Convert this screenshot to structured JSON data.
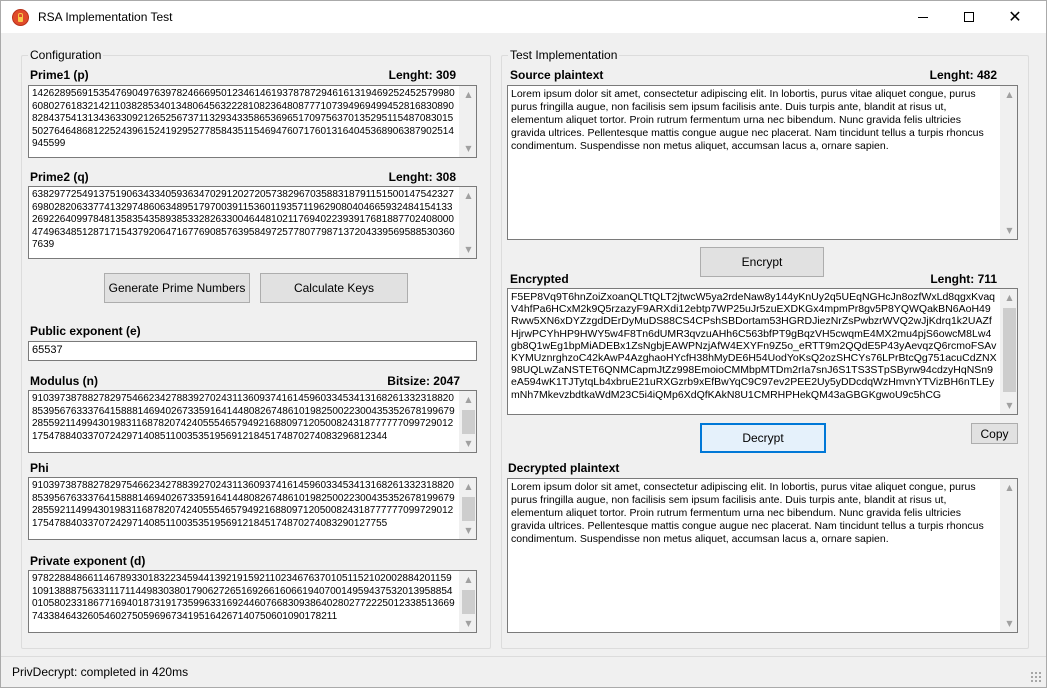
{
  "window": {
    "title": "RSA Implementation Test",
    "minimize_glyph": "",
    "close_glyph": "✕"
  },
  "config": {
    "group_title": "Configuration",
    "prime1": {
      "label": "Prime1 (p)",
      "length_label": "Lenght: 309",
      "value": "1426289569153547690497639782466695012346146193787872946161319469252452579980608027618321421103828534013480645632228108236480877710739496949945281683089082843754131343633092126525673711329343358653696517097563701352951154870830155027646486812252439615241929527785843511546947607176013164045368906387902514945599"
    },
    "prime2": {
      "label": "Prime2 (q)",
      "length_label": "Lenght: 308",
      "value": "63829772549137519063433405936347029120272057382967035883187911515001475423276980282063377413297486063489517970039115360119357119629080404665932484154133269226409978481358354358938533282633004644810211769402239391768188770240800047496348512871715437920647167769085763958497257780779871372043395695885303607639"
    },
    "generate_button": "Generate Prime Numbers",
    "calculate_button": "Calculate Keys",
    "public_exponent": {
      "label": "Public exponent (e)",
      "value": "65537"
    },
    "modulus": {
      "label": "Modulus (n)",
      "bitsize_label": "Bitsize: 2047",
      "value": "9103973878827829754662342788392702431136093741614596033453413168261332318820853956763337641588814694026733591641448082674861019825002230043535267819967928559211499430198311687820742405554657949216880971205008243187777770997290121754788403370724297140851100353519569121845174870274083296812344"
    },
    "phi": {
      "label": "Phi",
      "value": "9103973878827829754662342788392702431136093741614596033453413168261332318820853956763337641588814694026733591641448082674861019825002230043535267819967928559211499430198311687820742405554657949216880971205008243187777770997290121754788403370724297140851100353519569121845174870274083290127755"
    },
    "private_exponent": {
      "label": "Private exponent (d)",
      "value": "9782288486611467893301832234594413921915921102346763701051152102002884201159109138887563311171144983038017906272651692661606619407001495943753201395885401058023318677169401873191735996331692446076683093864028027722250123385136697433846432605460275059696734195164267140750601090178211"
    }
  },
  "test": {
    "group_title": "Test Implementation",
    "source": {
      "label": "Source plaintext",
      "length_label": "Lenght: 482",
      "value": "Lorem ipsum dolor sit amet, consectetur adipiscing elit. In lobortis, purus vitae aliquet congue, purus purus fringilla augue, non facilisis sem ipsum facilisis ante. Duis turpis ante, blandit at risus ut, elementum aliquet tortor. Proin rutrum fermentum urna nec bibendum. Nunc gravida felis ultricies gravida ultrices. Pellentesque mattis congue augue nec placerat. Nam tincidunt tellus a turpis rhoncus condimentum. Suspendisse non metus aliquet, accumsan lacus a, ornare sapien."
    },
    "encrypt_button": "Encrypt",
    "encrypted": {
      "label": "Encrypted",
      "length_label": "Lenght: 711",
      "value": "F5EP8Vq9T6hnZoiZxoanQLTtQLT2jtwcW5ya2rdeNaw8y144yKnUy2q5UEqNGHcJn8ozfWxLd8qgxKvaqV4hfPa6HCxM2k9Q5rzazyF9ARXdi12ebtp7WP25uJr5zuEXDKGx4mpmPr8gv5P8YQWQakBN6AoH49Rww5XN6xDYZzgdDErDyMuDS88CS4CPshSBDortam53HGRDJiezNrZsPwbzrWVQ2wJjKdrq1k2UAZfHjrwPCYhHP9HWY5w4F8Tn6dUMR3qvzuAHh6C563bfPT9gBqzVH5cwqmE4MX2mu4pjS6owcM8Lw4gb8Q1wEg1bpMiADEBx1ZsNgbjEAWPNzjAfW4EXYFn9Z5o_eRTT9m2QQdE5P43yAevqzQ6rcmoFSAvKYMUznrghzoC42kAwP4AzghaoHYcfH38hMyDE6H54UodYoKsQ2ozSHCYs76LPrBtcQg751acuCdZNX98UQLwZaNSTET6QNMCapmJtZz998EmoioCMMbpMTDm2rIa7snJ6S1TS3STpSByrw94cdzyHqNSn9eA594wK1TJTytqLb4xbruE21uRXGzrb9xEfBwYqC9C97ev2PEE2Uy5yDDcdqWzHmvnYTVizBH6nTLEymNh7MkevzbdtkaWdM23C5i4iQMp6XdQfKAkN8U1CMRHPHekQM43aGBGKgwoU9c5hCG"
    },
    "decrypt_button": "Decrypt",
    "copy_button": "Copy",
    "decrypted": {
      "label": "Decrypted plaintext",
      "value": "Lorem ipsum dolor sit amet, consectetur adipiscing elit. In lobortis, purus vitae aliquet congue, purus purus fringilla augue, non facilisis sem ipsum facilisis ante. Duis turpis ante, blandit at risus ut, elementum aliquet tortor. Proin rutrum fermentum urna nec bibendum. Nunc gravida felis ultricies gravida ultrices. Pellentesque mattis congue augue nec placerat. Nam tincidunt tellus a turpis rhoncus condimentum. Suspendisse non metus aliquet, accumsan lacus a, ornare sapien."
    }
  },
  "status": {
    "text": "PrivDecrypt: completed in 420ms"
  },
  "icons": {
    "scroll_up": "▲",
    "scroll_down": "▼"
  },
  "colors": {
    "focus_border": "#0078d7",
    "app_icon": "#e04a2a"
  }
}
